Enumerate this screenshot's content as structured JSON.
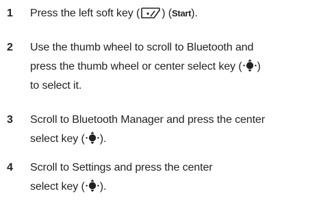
{
  "steps": [
    {
      "number": "1",
      "line1_a": "Press the left soft key (",
      "line1_b": ") (",
      "key_name": "Start",
      "line1_c": ")."
    },
    {
      "number": "2",
      "line1": "Use the thumb wheel to scroll to Bluetooth and",
      "line2_a": "press the thumb wheel or center select key (",
      "line2_b": ")",
      "line3": "to select it."
    },
    {
      "number": "3",
      "line1": "Scroll to Bluetooth Manager and press the center",
      "line2_a": "select key (",
      "line2_b": ")."
    },
    {
      "number": "4",
      "line1": "Scroll to Settings and press the center",
      "line2_a": "select key (",
      "line2_b": ")."
    }
  ],
  "icons": {
    "softkey": "left-soft-key-icon",
    "navkey": "center-select-key-icon"
  }
}
